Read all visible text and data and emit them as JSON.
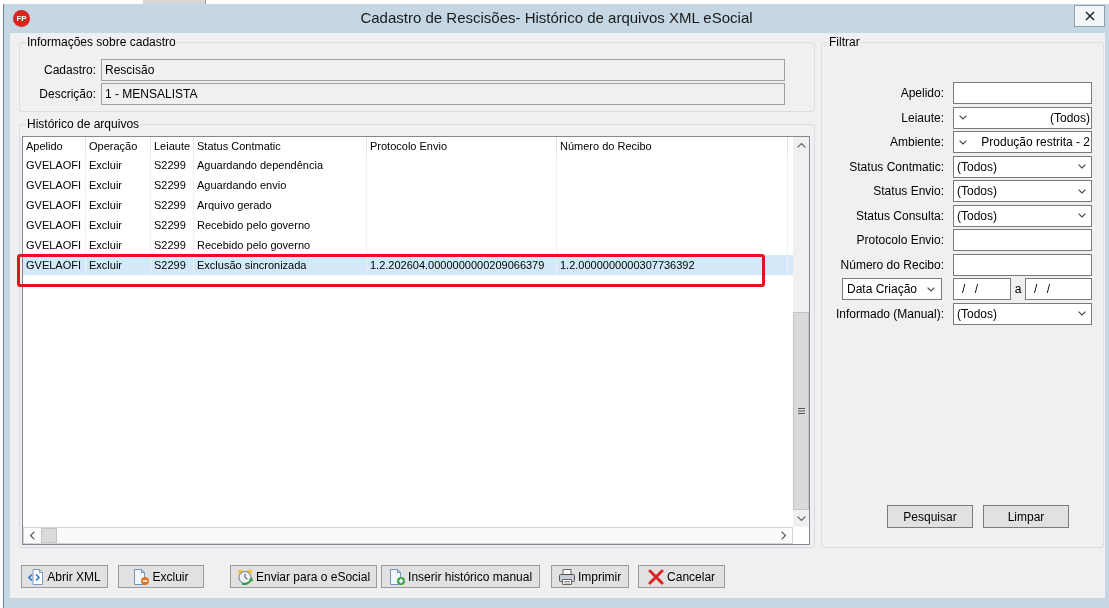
{
  "window": {
    "title": "Cadastro de Rescisões- Histórico de arquivos XML eSocial",
    "logo_text": "FP"
  },
  "info_group": {
    "title": "Informações sobre cadastro",
    "fields": [
      {
        "label": "Cadastro:",
        "value": "Rescisão"
      },
      {
        "label": "Descrição:",
        "value": "1 - MENSALISTA"
      }
    ]
  },
  "history": {
    "title": "Histórico de arquivos",
    "table": {
      "columns": [
        "Apelido",
        "Operação",
        "Leiaute",
        "Status Contmatic",
        "Protocolo Envio",
        "Número do Recibo"
      ],
      "rows": [
        {
          "apelido": "GVELAOFI",
          "operacao": "Excluir",
          "leiaute": "S2299",
          "status_contmatic": "Aguardando dependência",
          "selected": false,
          "outlined": false
        },
        {
          "apelido": "GVELAOFI",
          "operacao": "Excluir",
          "leiaute": "S2299",
          "status_contmatic": "Aguardando envio",
          "selected": false,
          "outlined": false
        },
        {
          "apelido": "GVELAOFI",
          "operacao": "Excluir",
          "leiaute": "S2299",
          "status_contmatic": "Arquivo gerado",
          "selected": false,
          "outlined": false
        },
        {
          "apelido": "GVELAOFI",
          "operacao": "Excluir",
          "leiaute": "S2299",
          "status_contmatic": "Recebido pelo governo",
          "selected": false,
          "outlined": false
        },
        {
          "apelido": "GVELAOFI",
          "operacao": "Excluir",
          "leiaute": "S2299",
          "status_contmatic": "Recebido pelo governo",
          "selected": false,
          "outlined": false
        },
        {
          "apelido": "GVELAOFI",
          "operacao": "Excluir",
          "leiaute": "S2299",
          "status_contmatic": "Exclusão sincronizada",
          "protocolo_envio": "1.2.202604.0000000000209066379",
          "numero_do_recibo": "1.2.0000000000307736392",
          "selected": true,
          "outlined": true
        }
      ]
    }
  },
  "filter": {
    "title": "Filtrar",
    "fields": [
      {
        "kind": "text",
        "label": "Apelido:"
      },
      {
        "kind": "combo_reversed",
        "label": "Leiaute:",
        "value": "(Todos)"
      },
      {
        "kind": "combo_reversed",
        "label": "Ambiente:",
        "value": "Produção restrita - 2"
      },
      {
        "kind": "combo",
        "label": "Status Contmatic:",
        "value": "(Todos)"
      },
      {
        "kind": "combo",
        "label": "Status Envio:",
        "value": "(Todos)"
      },
      {
        "kind": "combo",
        "label": "Status Consulta:",
        "value": "(Todos)"
      },
      {
        "kind": "text",
        "label": "Protocolo Envio:"
      },
      {
        "kind": "text",
        "label": "Número do Recibo:"
      },
      {
        "kind": "date_range",
        "selector": "Data Criação",
        "from": "/ /",
        "joiner": "a",
        "to": "/ /"
      },
      {
        "kind": "combo",
        "label": "Informado (Manual):",
        "value": "(Todos)"
      }
    ],
    "buttons": [
      "Pesquisar",
      "Limpar"
    ]
  },
  "buttons": [
    "Abrir XML",
    "Excluir",
    "Enviar para o eSocial",
    "Inserir histórico manual",
    "Imprimir",
    "Cancelar"
  ]
}
